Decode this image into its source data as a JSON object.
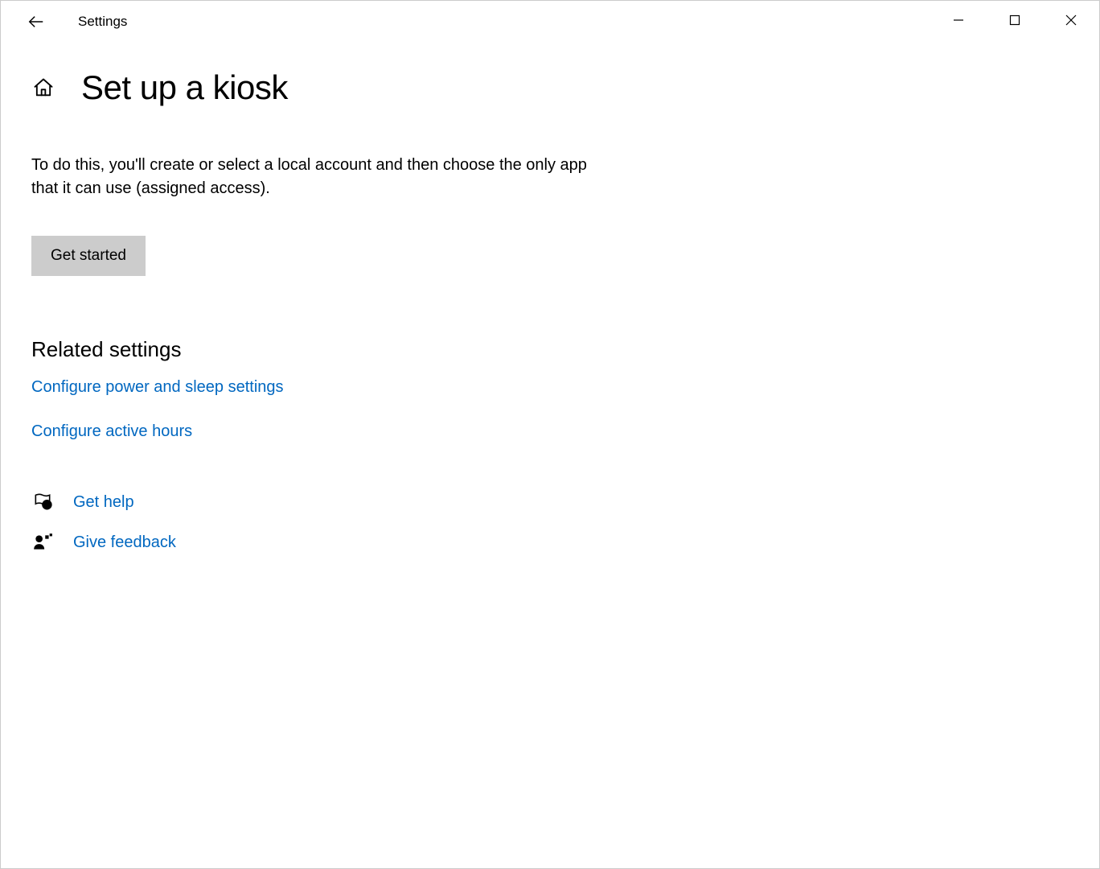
{
  "titlebar": {
    "app_name": "Settings"
  },
  "page": {
    "title": "Set up a kiosk",
    "description": "To do this, you'll create or select a local account and then choose the only app that it can use (assigned access).",
    "get_started_label": "Get started"
  },
  "related": {
    "heading": "Related settings",
    "links": [
      {
        "label": "Configure power and sleep settings"
      },
      {
        "label": "Configure active hours"
      }
    ]
  },
  "support": {
    "help_label": "Get help",
    "feedback_label": "Give feedback"
  },
  "colors": {
    "link": "#0067c0",
    "button_bg": "#cccccc"
  }
}
